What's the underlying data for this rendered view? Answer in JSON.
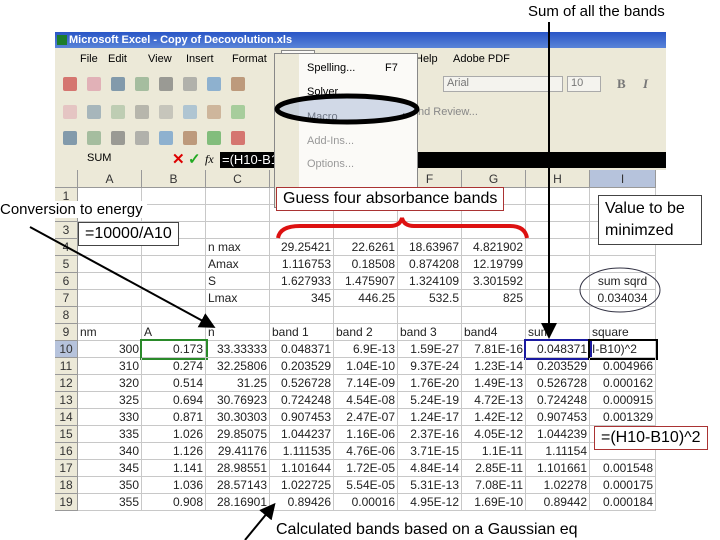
{
  "slide": {
    "top_label": "Sum of all the bands",
    "conversion_label": "Conversion to energy",
    "conversion_formula": "=10000/A10",
    "guess_label": "Guess four absorbance bands",
    "minimize_label": "Value to be minimzed",
    "square_formula": "=(H10-B10)^2",
    "bottom_label": "Calculated bands based on a Gaussian eq"
  },
  "excel": {
    "title": "Microsoft Excel - Copy of Decovolution.xls",
    "menu": [
      "File",
      "Edit",
      "View",
      "Insert",
      "Format",
      "Tools",
      "Data",
      "Window",
      "Help",
      "Adobe PDF"
    ],
    "tools_menu": {
      "items": [
        {
          "label": "Spelling...",
          "shortcut": "F7"
        },
        {
          "label": "Solver..."
        },
        {
          "label": "Macro",
          "submenu": true
        },
        {
          "label": "Add-Ins..."
        },
        {
          "label": "Options..."
        }
      ],
      "highlighted": "Solver..."
    },
    "font": "Arial",
    "font_size": "10",
    "bold": "B",
    "italic": "I",
    "review_label": "nd Review...",
    "name_box": "SUM",
    "formula": "=(H10-B1",
    "fx": "fx",
    "columns": [
      "A",
      "B",
      "C",
      "D",
      "E",
      "F",
      "G",
      "H",
      "I"
    ],
    "selected_column": "I",
    "rows": [
      {
        "n": "1",
        "cells": []
      },
      {
        "n": "2",
        "cells": []
      },
      {
        "n": "3",
        "cells": []
      },
      {
        "n": "4",
        "cells": [
          "",
          "",
          "n max",
          "29.25421",
          "22.6261",
          "18.63967",
          "4.821902",
          "",
          ""
        ]
      },
      {
        "n": "5",
        "cells": [
          "",
          "",
          "Amax",
          "1.116753",
          "0.18508",
          "0.874208",
          "12.19799",
          "",
          ""
        ]
      },
      {
        "n": "6",
        "cells": [
          "",
          "",
          "S",
          "1.627933",
          "1.475907",
          "1.324109",
          "3.301592",
          "",
          "sum sqrd"
        ]
      },
      {
        "n": "7",
        "cells": [
          "",
          "",
          "Lmax",
          "345",
          "446.25",
          "532.5",
          "825",
          "",
          "0.034034"
        ]
      },
      {
        "n": "8",
        "cells": []
      },
      {
        "n": "9",
        "cells": [
          "nm",
          "A",
          "n",
          "band 1",
          "band 2",
          "band 3",
          "band4",
          "sum",
          "square"
        ]
      },
      {
        "n": "10",
        "cells": [
          "300",
          "0.173",
          "33.33333",
          "0.048371",
          "6.9E-13",
          "1.59E-27",
          "7.81E-16",
          "0.048371",
          "I-B10)^2"
        ]
      },
      {
        "n": "11",
        "cells": [
          "310",
          "0.274",
          "32.25806",
          "0.203529",
          "1.04E-10",
          "9.37E-24",
          "1.23E-14",
          "0.203529",
          "0.004966"
        ]
      },
      {
        "n": "12",
        "cells": [
          "320",
          "0.514",
          "31.25",
          "0.526728",
          "7.14E-09",
          "1.76E-20",
          "1.49E-13",
          "0.526728",
          "0.000162"
        ]
      },
      {
        "n": "13",
        "cells": [
          "325",
          "0.694",
          "30.76923",
          "0.724248",
          "4.54E-08",
          "5.24E-19",
          "4.72E-13",
          "0.724248",
          "0.000915"
        ]
      },
      {
        "n": "14",
        "cells": [
          "330",
          "0.871",
          "30.30303",
          "0.907453",
          "2.47E-07",
          "1.24E-17",
          "1.42E-12",
          "0.907453",
          "0.001329"
        ]
      },
      {
        "n": "15",
        "cells": [
          "335",
          "1.026",
          "29.85075",
          "1.044237",
          "1.16E-06",
          "2.37E-16",
          "4.05E-12",
          "1.044239",
          ""
        ]
      },
      {
        "n": "16",
        "cells": [
          "340",
          "1.126",
          "29.41176",
          "1.111535",
          "4.76E-06",
          "3.71E-15",
          "1.1E-11",
          "1.11154",
          ""
        ]
      },
      {
        "n": "17",
        "cells": [
          "345",
          "1.141",
          "28.98551",
          "1.101644",
          "1.72E-05",
          "4.84E-14",
          "2.85E-11",
          "1.101661",
          "0.001548"
        ]
      },
      {
        "n": "18",
        "cells": [
          "350",
          "1.036",
          "28.57143",
          "1.022725",
          "5.54E-05",
          "5.31E-13",
          "7.08E-11",
          "1.02278",
          "0.000175"
        ]
      },
      {
        "n": "19",
        "cells": [
          "355",
          "0.908",
          "28.16901",
          "0.89426",
          "0.00016",
          "4.95E-12",
          "1.69E-10",
          "0.89442",
          "0.000184"
        ]
      }
    ]
  },
  "colors": {
    "brace": "#dd1111",
    "title_bar": "#2a56c6",
    "selection": "#b6c3dc"
  }
}
